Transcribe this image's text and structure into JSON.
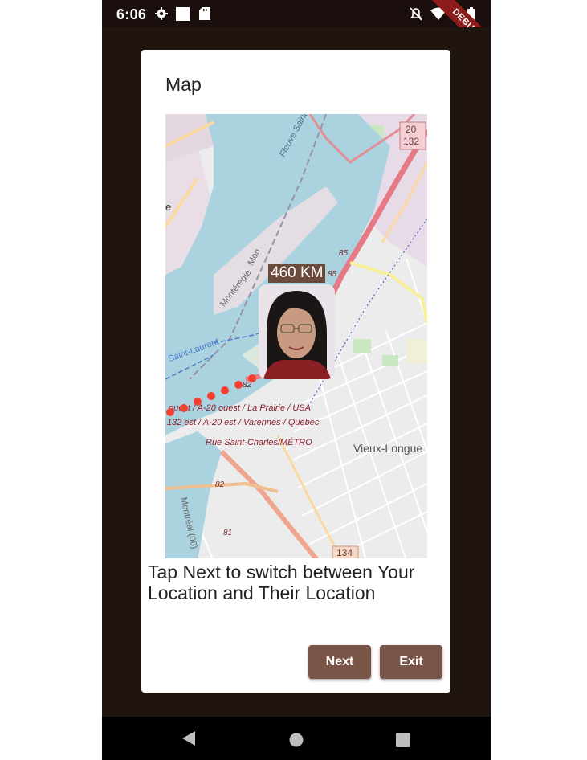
{
  "status_bar": {
    "time": "6:06",
    "debug_label": "DEBUG"
  },
  "dialog": {
    "title": "Map",
    "distance_label": "460 KM",
    "hint": "Tap Next to switch between Your Location and Their Location",
    "buttons": {
      "next": "Next",
      "exit": "Exit"
    }
  },
  "map": {
    "labels": {
      "river": "Fleuve Saint-Laurent",
      "mont": "Mon",
      "monteregie": "Montérégie",
      "saint_laurent": "Saint-Laurent",
      "road1": "ouest / A-20 ouest / La Prairie / USA",
      "road2": "132 est / A-20 est / Varennes / Québec",
      "road3": "Rue Saint-Charles/MÉTRO",
      "vieux": "Vieux-Longue",
      "montreal": "Montréal (06)",
      "shield_20": "20",
      "shield_132": "132",
      "shield_134": "134",
      "r85a": "85",
      "r85b": "85",
      "r82a": "82",
      "r82b": "82",
      "r81": "81",
      "e": "e"
    },
    "route_color": "#f4412f",
    "water_color": "#aad3df"
  },
  "nav_bar": {
    "icons": [
      "back-icon",
      "home-icon",
      "recents-icon"
    ]
  }
}
